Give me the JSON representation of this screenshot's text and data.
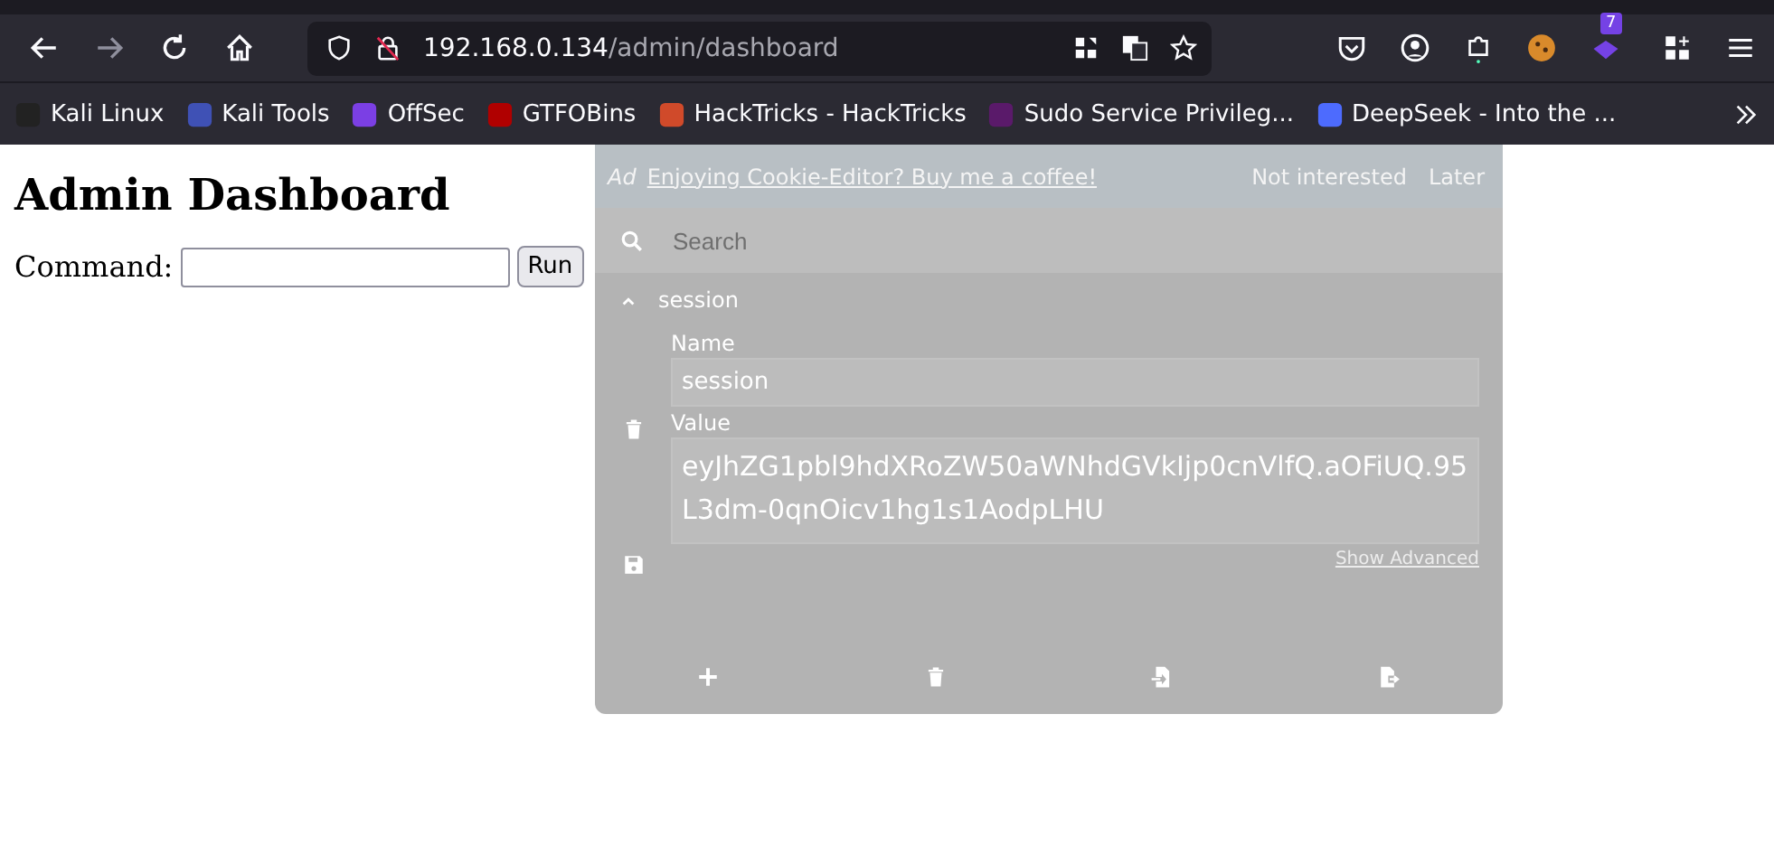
{
  "browser": {
    "url_host": "192.168.0.134",
    "url_path": "/admin/dashboard",
    "extension_badge": "7"
  },
  "bookmarks": [
    {
      "label": "Kali Linux",
      "color": "#222222"
    },
    {
      "label": "Kali Tools",
      "color": "#3f51b5"
    },
    {
      "label": "OffSec",
      "color": "#7b3fe4"
    },
    {
      "label": "GTFOBins",
      "color": "#b00000"
    },
    {
      "label": "HackTricks - HackTricks",
      "color": "#d04a2a"
    },
    {
      "label": "Sudo Service Privileg...",
      "color": "#5a1a6a"
    },
    {
      "label": "DeepSeek - Into the ...",
      "color": "#4d6bfe"
    }
  ],
  "page": {
    "heading": "Admin Dashboard",
    "command_label": "Command:",
    "run_button": "Run"
  },
  "cookie_editor": {
    "ad_tag": "Ad",
    "ad_link": "Enjoying Cookie-Editor? Buy me a coffee!",
    "not_interested": "Not interested",
    "later": "Later",
    "search_placeholder": "Search",
    "cookies": [
      {
        "name": "session",
        "expanded": true,
        "name_label": "Name",
        "name_value": "session",
        "value_label": "Value",
        "value": "eyJhZG1pbl9hdXRoZW50aWNhdGVkIjp0cnVlfQ.aOFiUQ.95L3dm-0qnOicv1hg1s1AodpLHU",
        "show_advanced": "Show Advanced"
      }
    ]
  }
}
